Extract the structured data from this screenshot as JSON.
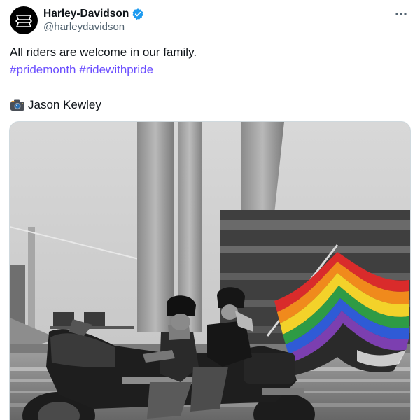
{
  "author": {
    "display_name": "Harley-Davidson",
    "handle": "@harleydavidson",
    "avatar_icon": "harley-davidson-logo",
    "verified": true,
    "verified_color": "#1d9bf0"
  },
  "tweet": {
    "text": "All riders are welcome in our family.",
    "hashtags": [
      "#pridemonth",
      "#ridewithpride"
    ],
    "hashtag_color": "#6b4eff",
    "credit_icon": "camera-icon",
    "credit_name": "Jason Kewley"
  },
  "menu": {
    "icon": "more-horizontal-icon"
  },
  "media": {
    "type": "photo",
    "content": "black-and-white photo of two riders on a motorcycle carrying a rainbow pride flag",
    "flag_colors": [
      "#e40303",
      "#ff8c00",
      "#ffed00",
      "#008026",
      "#24408e",
      "#732982"
    ]
  }
}
